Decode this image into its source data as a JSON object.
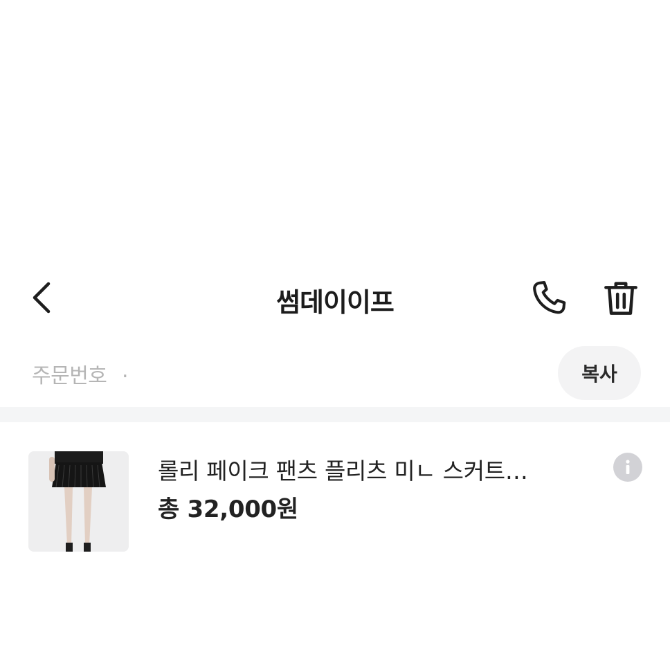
{
  "header": {
    "title": "썸데이이프",
    "back_icon": "chevron-left-icon",
    "call_icon": "phone-icon",
    "delete_icon": "trash-icon"
  },
  "order": {
    "label": "주문번호",
    "number": ".",
    "copy_label": "복사"
  },
  "product": {
    "name": "롤리 페이크 팬츠 플리츠 미ㄴ  스커트…",
    "price": "총 32,000원",
    "info_icon": "info-icon"
  },
  "colors": {
    "text": "#1e1e1e",
    "muted": "#b5b5b5",
    "button_bg": "#f3f3f4",
    "divider": "#f4f5f6",
    "info_bg": "#d2d2d6"
  }
}
